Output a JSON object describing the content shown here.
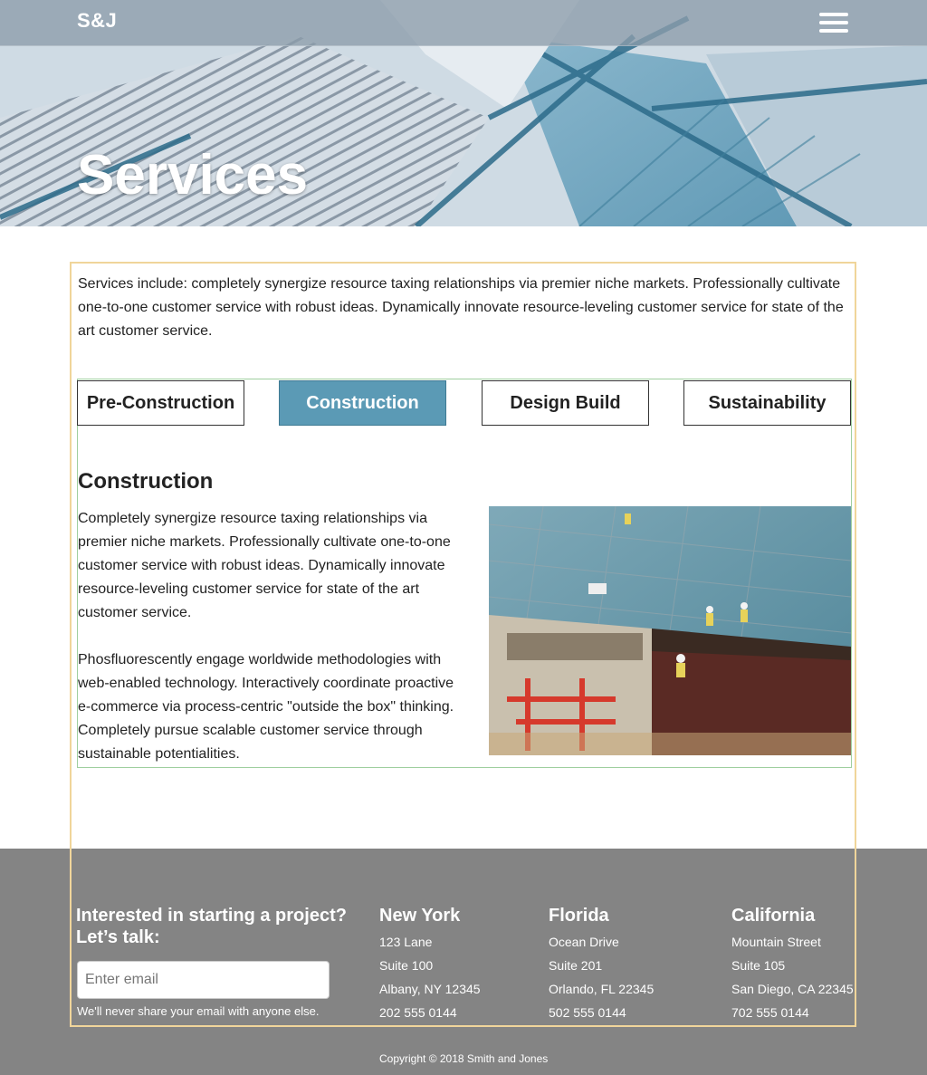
{
  "navbar": {
    "brand": "S&J",
    "menu_icon": "hamburger-menu-icon"
  },
  "hero": {
    "title": "Services"
  },
  "intro": {
    "text": "Services include: completely synergize resource taxing relationships via premier niche markets. Professionally cultivate one-to-one customer service with robust ideas. Dynamically innovate resource-leveling customer service for state of the art customer service."
  },
  "tabs": [
    {
      "label": "Pre-Construction",
      "active": false
    },
    {
      "label": "Construction",
      "active": true
    },
    {
      "label": "Design Build",
      "active": false
    },
    {
      "label": "Sustainability",
      "active": false
    }
  ],
  "content": {
    "heading": "Construction",
    "paragraph1": "Completely synergize resource taxing relationships via premier niche markets. Professionally cultivate one-to-one customer service with robust ideas. Dynamically innovate resource-leveling customer service for state of the art customer service.",
    "paragraph2": "Phosfluorescently engage worldwide methodologies with web-enabled technology. Interactively coordinate proactive e-commerce via process-centric \"outside the box\" thinking. Completely pursue scalable customer service through sustainable potentialities."
  },
  "footer": {
    "cta": "Interested in starting a project? Let’s talk:",
    "email_placeholder": "Enter email",
    "email_help": "We'll never share your email with anyone else.",
    "offices": [
      {
        "name": "New York",
        "street": "123 Lane",
        "suite": "Suite 100",
        "city": "Albany, NY 12345",
        "phone": "202 555 0144"
      },
      {
        "name": "Florida",
        "street": "Ocean Drive",
        "suite": "Suite 201",
        "city": "Orlando, FL 22345",
        "phone": "502 555 0144"
      },
      {
        "name": "California",
        "street": "Mountain Street",
        "suite": "Suite 105",
        "city": "San Diego, CA 22345",
        "phone": "702 555 0144"
      }
    ],
    "copyright": "Copyright © 2018 Smith and Jones"
  },
  "colors": {
    "active_tab": "#5b9ab5",
    "footer_bg": "#848484",
    "container_outline": "#f0d59a",
    "tabs_outline": "#9fcf9f"
  }
}
